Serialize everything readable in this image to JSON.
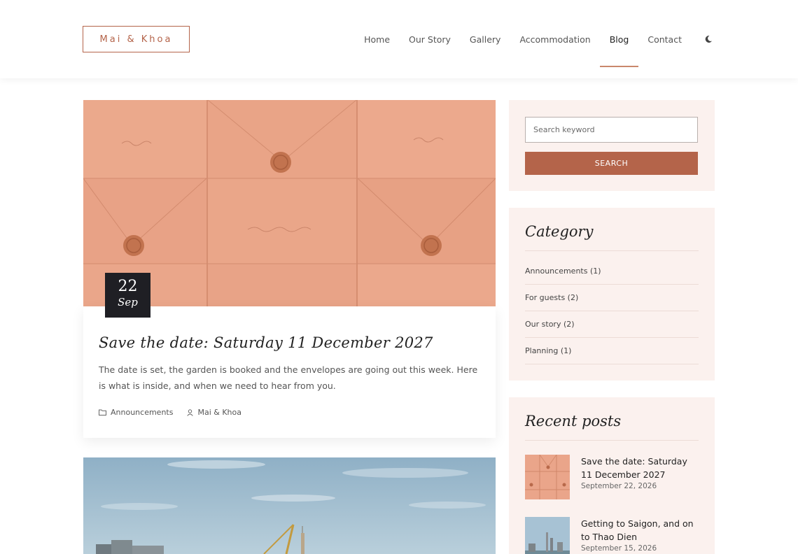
{
  "header": {
    "logo": "Mai & Khoa",
    "nav": [
      "Home",
      "Our Story",
      "Gallery",
      "Accommodation",
      "Blog",
      "Contact"
    ],
    "active_nav": "Blog",
    "theme_icon": "moon-icon"
  },
  "post": {
    "day": "22",
    "month": "Sep",
    "title": "Save the date: Saturday 11 December 2027",
    "excerpt": "The date is set, the garden is booked and the envelopes are going out this week. Here is what is inside, and when we need to hear from you.",
    "category": "Announcements",
    "author": "Mai & Khoa"
  },
  "sidebar": {
    "search": {
      "placeholder": "Search keyword",
      "button": "SEARCH"
    },
    "category": {
      "title": "Category",
      "items": [
        "Announcements (1)",
        "For guests (2)",
        "Our story (2)",
        "Planning (1)"
      ]
    },
    "recent": {
      "title": "Recent posts",
      "items": [
        {
          "title": "Save the date: Saturday 11 December 2027",
          "date": "September 22, 2026"
        },
        {
          "title": "Getting to Saigon, and on to Thao Dien",
          "date": "September 15, 2026"
        }
      ]
    }
  },
  "colors": {
    "accent": "#b4644a",
    "sidebar_bg": "#fbf1ee",
    "badge_bg": "#1f1f24"
  }
}
